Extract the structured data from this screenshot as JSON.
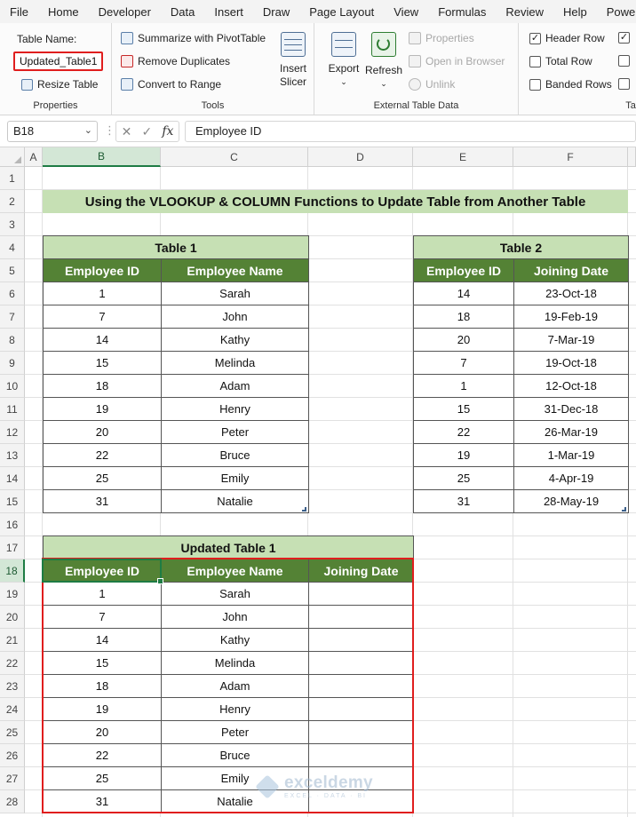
{
  "menu": [
    "File",
    "Home",
    "Developer",
    "Data",
    "Insert",
    "Draw",
    "Page Layout",
    "View",
    "Formulas",
    "Review",
    "Help",
    "Power"
  ],
  "ribbon": {
    "properties": {
      "table_name_label": "Table Name:",
      "table_name_value": "Updated_Table1",
      "resize_table": "Resize Table",
      "group_label": "Properties"
    },
    "tools": {
      "summarize": "Summarize with PivotTable",
      "remove_duplicates": "Remove Duplicates",
      "convert_to_range": "Convert to Range",
      "insert_slicer_line1": "Insert",
      "insert_slicer_line2": "Slicer",
      "group_label": "Tools"
    },
    "external": {
      "export": "Export",
      "refresh": "Refresh",
      "properties": "Properties",
      "open_in_browser": "Open in Browser",
      "unlink": "Unlink",
      "group_label": "External Table Data"
    },
    "style_options": {
      "header_row": "Header Row",
      "total_row": "Total Row",
      "banded_rows": "Banded Rows",
      "group_label": "Tab"
    }
  },
  "formula_bar": {
    "name_box": "B18",
    "fx": "fx",
    "content": "Employee ID"
  },
  "sheet": {
    "col_letters": [
      "A",
      "B",
      "C",
      "D",
      "E",
      "F"
    ],
    "row_numbers": [
      "1",
      "2",
      "3",
      "4",
      "5",
      "6",
      "7",
      "8",
      "9",
      "10",
      "11",
      "12",
      "13",
      "14",
      "15",
      "16",
      "17",
      "18",
      "19",
      "20",
      "21",
      "22",
      "23",
      "24",
      "25",
      "26",
      "27",
      "28"
    ],
    "title": "Using the VLOOKUP & COLUMN Functions to Update Table from Another Table",
    "table1": {
      "caption": "Table 1",
      "headers": [
        "Employee ID",
        "Employee Name"
      ],
      "rows": [
        [
          "1",
          "Sarah"
        ],
        [
          "7",
          "John"
        ],
        [
          "14",
          "Kathy"
        ],
        [
          "15",
          "Melinda"
        ],
        [
          "18",
          "Adam"
        ],
        [
          "19",
          "Henry"
        ],
        [
          "20",
          "Peter"
        ],
        [
          "22",
          "Bruce"
        ],
        [
          "25",
          "Emily"
        ],
        [
          "31",
          "Natalie"
        ]
      ]
    },
    "table2": {
      "caption": "Table 2",
      "headers": [
        "Employee ID",
        "Joining Date"
      ],
      "rows": [
        [
          "14",
          "23-Oct-18"
        ],
        [
          "18",
          "19-Feb-19"
        ],
        [
          "20",
          "7-Mar-19"
        ],
        [
          "7",
          "19-Oct-18"
        ],
        [
          "1",
          "12-Oct-18"
        ],
        [
          "15",
          "31-Dec-18"
        ],
        [
          "22",
          "26-Mar-19"
        ],
        [
          "19",
          "1-Mar-19"
        ],
        [
          "25",
          "4-Apr-19"
        ],
        [
          "31",
          "28-May-19"
        ]
      ]
    },
    "table3": {
      "caption": "Updated Table 1",
      "headers": [
        "Employee ID",
        "Employee Name",
        "Joining Date"
      ],
      "rows": [
        [
          "1",
          "Sarah",
          ""
        ],
        [
          "7",
          "John",
          ""
        ],
        [
          "14",
          "Kathy",
          ""
        ],
        [
          "15",
          "Melinda",
          ""
        ],
        [
          "18",
          "Adam",
          ""
        ],
        [
          "19",
          "Henry",
          ""
        ],
        [
          "20",
          "Peter",
          ""
        ],
        [
          "22",
          "Bruce",
          ""
        ],
        [
          "25",
          "Emily",
          ""
        ],
        [
          "31",
          "Natalie",
          ""
        ]
      ]
    }
  },
  "watermark": {
    "name": "exceldemy",
    "tagline": "EXCEL · DATA · BI"
  },
  "colors": {
    "caption_fill": "#c6e0b4",
    "header_fill": "#548235",
    "highlight_border": "#e01e1e",
    "selection": "#1e7c44"
  }
}
